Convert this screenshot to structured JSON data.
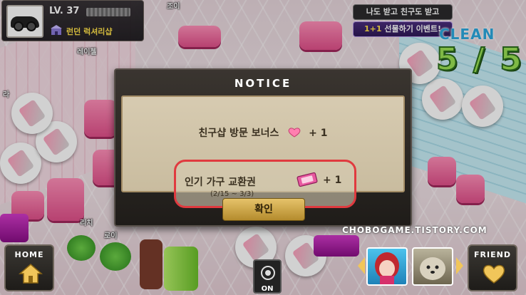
{
  "player": {
    "level": "LV. 37",
    "shop_name": "런던 럭셔리샵"
  },
  "event_banner": {
    "line1": "나도 받고 친구도 받고",
    "line2_highlight": "1+1",
    "line2_rest": " 선물하기 이벤트!"
  },
  "clean": {
    "label": "CLEAN",
    "count": "5 / 5"
  },
  "scene_labels": {
    "label_1": "조이",
    "label_2": "레이첼",
    "label_3": "라",
    "label_4": "리치",
    "label_5": "로이"
  },
  "notice": {
    "title": "NOTICE",
    "bonus_label": "친구샵 방문 보너스",
    "bonus_qty": "+ 1",
    "ticket_label": "인기 가구 교환권",
    "ticket_dates": "(2/15 ~ 3/3)",
    "ticket_qty": "+ 1",
    "confirm_label": "확인"
  },
  "hud": {
    "home_label": "HOME",
    "friend_label": "FRIEND",
    "on_label": "ON"
  },
  "watermark": "CHOBOGAME.TISTORY.COM",
  "colors": {
    "highlight_red": "#e03a3f",
    "gold_button": "#d4ad4f",
    "clean_green": "#9be255",
    "clean_blue": "#2ba9e0"
  }
}
